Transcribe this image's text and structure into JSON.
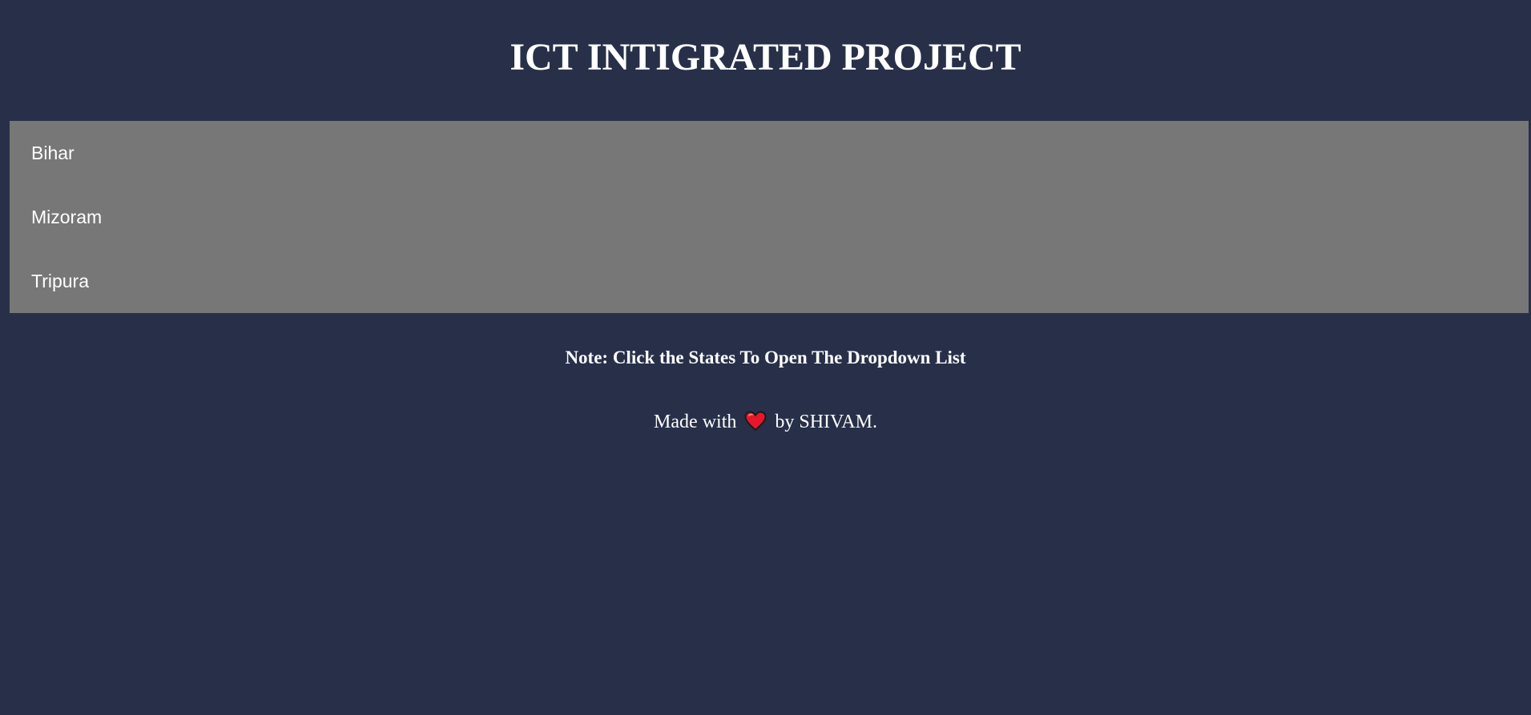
{
  "header": {
    "title": "ICT INTIGRATED PROJECT"
  },
  "states": [
    {
      "label": "Bihar"
    },
    {
      "label": "Mizoram"
    },
    {
      "label": "Tripura"
    }
  ],
  "note": "Note: Click the States To Open The Dropdown List",
  "footer": {
    "prefix": "Made with",
    "icon": "heart-icon",
    "suffix": "by SHIVAM."
  },
  "colors": {
    "background": "#283049",
    "list_background": "#777777",
    "text": "#ffffff",
    "heart": "#e8162a"
  }
}
